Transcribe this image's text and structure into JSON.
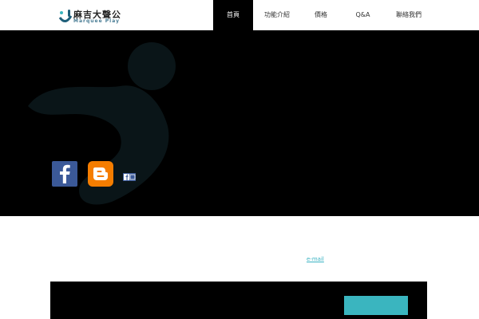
{
  "brand": {
    "title": "麻吉大聲公",
    "subtitle": "Marquee Play"
  },
  "nav": {
    "items": [
      {
        "label": "首頁",
        "active": true
      },
      {
        "label": "功能介紹",
        "active": false
      },
      {
        "label": "價格",
        "active": false
      },
      {
        "label": "Q&A",
        "active": false
      },
      {
        "label": "聯絡我們",
        "active": false
      }
    ]
  },
  "hero": {
    "title": "",
    "lines": [
      "",
      "",
      ""
    ],
    "social": {
      "facebook_icon": "facebook-icon",
      "blogger_icon": "blogger-icon",
      "small_icon": "facebook-share-icon"
    }
  },
  "features": [
    {
      "title": "",
      "body": "",
      "link_text": ""
    },
    {
      "title": "",
      "body": "",
      "link_text": ""
    },
    {
      "title": "",
      "body_pre": "",
      "link_text": "e-mail",
      "body_post": ""
    }
  ],
  "cta": {
    "text": "",
    "button_label": ""
  },
  "colors": {
    "accent": "#3ab5bf",
    "link": "#3bb3c3",
    "hero_bg": "#000000",
    "facebook": "#3b5998",
    "blogger": "#f57d00"
  }
}
